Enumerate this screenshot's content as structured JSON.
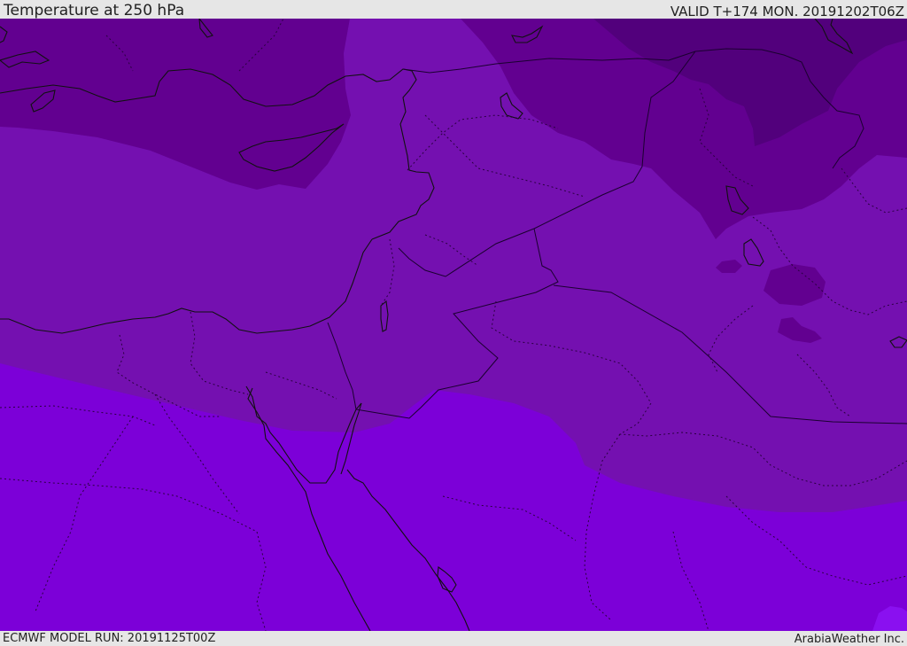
{
  "header": {
    "title": "Temperature at 250 hPa",
    "valid_time": "VALID T+174 MON. 20191202T06Z"
  },
  "footer": {
    "model_run": "ECMWF MODEL RUN: 20191125T00Z",
    "credit": "ArabiaWeather Inc."
  },
  "map": {
    "colors": {
      "band_darkest": "#52007c",
      "band_dark": "#620090",
      "band_mid": "#7410b0",
      "band_warm": "#7c00d8",
      "band_warmest": "#8a10f0",
      "coastline": "#111111",
      "border": "#2a0040"
    }
  }
}
